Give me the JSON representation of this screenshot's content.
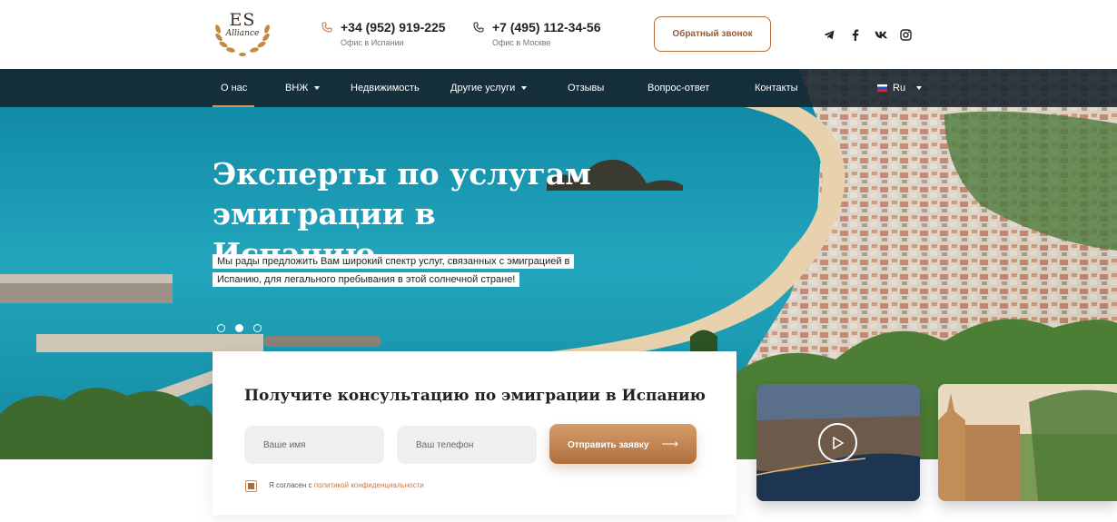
{
  "header": {
    "logo_es": "ES",
    "logo_sub": "Alliance",
    "phones": [
      {
        "number": "+34 (952) 919-225",
        "label": "Офис в Испании"
      },
      {
        "number": "+7 (495) 112-34-56",
        "label": "Офис в Москве"
      }
    ],
    "callback_label": "Обратный звонок",
    "socials": [
      "telegram-icon",
      "facebook-icon",
      "vk-icon",
      "instagram-icon"
    ]
  },
  "nav": {
    "items": [
      {
        "label": "О нас",
        "dropdown": false,
        "active": true
      },
      {
        "label": "ВНЖ",
        "dropdown": true
      },
      {
        "label": "Недвижимость",
        "dropdown": false
      },
      {
        "label": "Другие услуги",
        "dropdown": true
      },
      {
        "label": "Отзывы",
        "dropdown": false
      },
      {
        "label": "Вопрос-ответ",
        "dropdown": false
      },
      {
        "label": "Контакты",
        "dropdown": false
      }
    ],
    "language": "Ru"
  },
  "hero": {
    "title_line1": "Эксперты по услугам",
    "title_line2_normal": "эмиграции ",
    "title_line2_bold": "в Испанию",
    "subtitle": "Мы рады предложить Вам широкий спектр услуг, связанных с эмиграцией в Испанию, для легального пребывания в этой солнечной стране!",
    "slides_total": 3,
    "active_slide": 2
  },
  "form": {
    "title": "Получите консультацию по эмиграции в Испанию",
    "name_placeholder": "Ваше имя",
    "phone_placeholder": "Ваш телефон",
    "submit_label": "Отправить заявку",
    "agree_text": "Я согласен с ",
    "agree_link": "политикой конфиденциальности",
    "agree_checked": true
  },
  "colors": {
    "accent": "#b06a3a",
    "nav_bg": "#16222c",
    "sea": "#1a9cb2"
  }
}
